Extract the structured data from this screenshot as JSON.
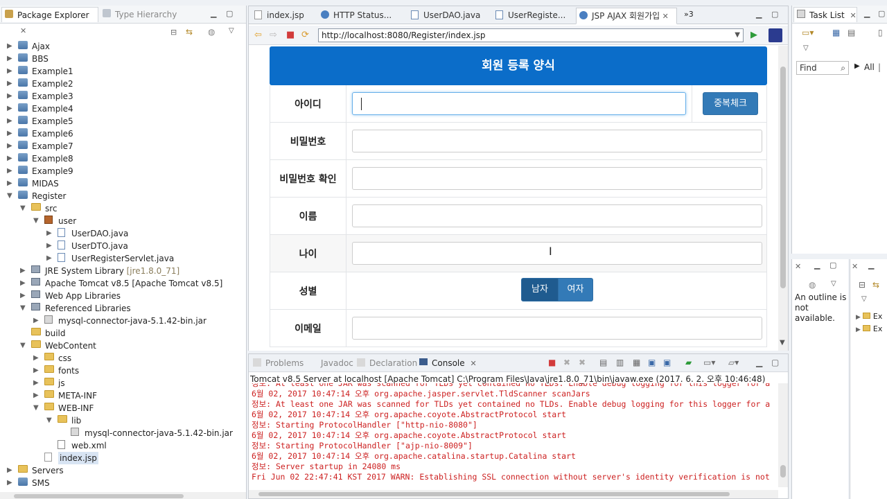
{
  "package_explorer": {
    "tab_label": "Package Explorer",
    "tab2_label": "Type Hierarchy",
    "tree": [
      {
        "label": "Ajax",
        "depth": 0,
        "icon": "project-icon",
        "expanded": false
      },
      {
        "label": "BBS",
        "depth": 0,
        "icon": "project-icon",
        "expanded": false
      },
      {
        "label": "Example1",
        "depth": 0,
        "icon": "project-icon",
        "expanded": false
      },
      {
        "label": "Example2",
        "depth": 0,
        "icon": "project-icon",
        "expanded": false
      },
      {
        "label": "Example3",
        "depth": 0,
        "icon": "project-icon",
        "expanded": false
      },
      {
        "label": "Example4",
        "depth": 0,
        "icon": "project-icon",
        "expanded": false
      },
      {
        "label": "Example5",
        "depth": 0,
        "icon": "project-icon",
        "expanded": false
      },
      {
        "label": "Example6",
        "depth": 0,
        "icon": "project-icon",
        "expanded": false
      },
      {
        "label": "Example7",
        "depth": 0,
        "icon": "project-icon",
        "expanded": false
      },
      {
        "label": "Example8",
        "depth": 0,
        "icon": "project-icon",
        "expanded": false
      },
      {
        "label": "Example9",
        "depth": 0,
        "icon": "project-icon",
        "expanded": false
      },
      {
        "label": "MIDAS",
        "depth": 0,
        "icon": "project-icon",
        "expanded": false
      },
      {
        "label": "Register",
        "depth": 0,
        "icon": "project-icon",
        "expanded": true
      },
      {
        "label": "src",
        "depth": 1,
        "icon": "source-folder-icon",
        "expanded": true
      },
      {
        "label": "user",
        "depth": 2,
        "icon": "package-icon",
        "expanded": true
      },
      {
        "label": "UserDAO.java",
        "depth": 3,
        "icon": "java-file-icon",
        "expanded": false
      },
      {
        "label": "UserDTO.java",
        "depth": 3,
        "icon": "java-file-icon",
        "expanded": false
      },
      {
        "label": "UserRegisterServlet.java",
        "depth": 3,
        "icon": "java-file-icon",
        "expanded": false
      },
      {
        "label": "JRE System Library",
        "deco": "[jre1.8.0_71]",
        "depth": 1,
        "icon": "library-icon",
        "expanded": false
      },
      {
        "label": "Apache Tomcat v8.5 [Apache Tomcat v8.5]",
        "depth": 1,
        "icon": "library-icon",
        "expanded": false
      },
      {
        "label": "Web App Libraries",
        "depth": 1,
        "icon": "library-icon",
        "expanded": false
      },
      {
        "label": "Referenced Libraries",
        "depth": 1,
        "icon": "library-icon",
        "expanded": true
      },
      {
        "label": "mysql-connector-java-5.1.42-bin.jar",
        "depth": 2,
        "icon": "jar-icon",
        "expanded": false
      },
      {
        "label": "build",
        "depth": 1,
        "icon": "folder-icon",
        "expanded": null
      },
      {
        "label": "WebContent",
        "depth": 1,
        "icon": "folder-icon",
        "expanded": true
      },
      {
        "label": "css",
        "depth": 2,
        "icon": "folder-icon",
        "expanded": false
      },
      {
        "label": "fonts",
        "depth": 2,
        "icon": "folder-icon",
        "expanded": false
      },
      {
        "label": "js",
        "depth": 2,
        "icon": "folder-icon",
        "expanded": false
      },
      {
        "label": "META-INF",
        "depth": 2,
        "icon": "folder-icon",
        "expanded": false
      },
      {
        "label": "WEB-INF",
        "depth": 2,
        "icon": "folder-icon",
        "expanded": true
      },
      {
        "label": "lib",
        "depth": 3,
        "icon": "folder-icon",
        "expanded": true
      },
      {
        "label": "mysql-connector-java-5.1.42-bin.jar",
        "depth": 4,
        "icon": "jar-icon",
        "expanded": null
      },
      {
        "label": "web.xml",
        "depth": 3,
        "icon": "xml-file-icon",
        "expanded": null
      },
      {
        "label": "index.jsp",
        "depth": 2,
        "icon": "jsp-file-icon",
        "expanded": null,
        "selected": true
      },
      {
        "label": "Servers",
        "depth": 0,
        "icon": "folder-icon",
        "expanded": false
      },
      {
        "label": "SMS",
        "depth": 0,
        "icon": "project-icon",
        "expanded": false
      }
    ]
  },
  "editor": {
    "tabs": [
      {
        "label": "index.jsp",
        "icon": "jsp-file-icon"
      },
      {
        "label": "HTTP Status...",
        "icon": "globe-icon"
      },
      {
        "label": "UserDAO.java",
        "icon": "java-file-icon"
      },
      {
        "label": "UserRegiste...",
        "icon": "java-file-icon"
      },
      {
        "label": "JSP AJAX 회원가입",
        "icon": "globe-icon",
        "active": true
      }
    ],
    "overflow_label": "»3",
    "url": "http://localhost:8080/Register/index.jsp",
    "form": {
      "title": "회원 등록 양식",
      "fields": [
        {
          "label": "아이디",
          "value": ""
        },
        {
          "label": "비밀번호",
          "value": ""
        },
        {
          "label": "비밀번호 확인",
          "value": ""
        },
        {
          "label": "이름",
          "value": ""
        },
        {
          "label": "나이",
          "value": ""
        },
        {
          "label": "성별"
        },
        {
          "label": "이메일",
          "value": ""
        }
      ],
      "dup_check_label": "중복체크",
      "gender_options": [
        "남자",
        "여자"
      ],
      "gender_selected": "남자"
    }
  },
  "console": {
    "tabs": [
      "Problems",
      "Javadoc",
      "Declaration",
      "Console"
    ],
    "active_tab": "Console",
    "header": "Tomcat v8.5 Server at localhost [Apache Tomcat] C:\\Program Files\\Java\\jre1.8.0_71\\bin\\javaw.exe (2017. 6. 2. 오후 10:46:48)",
    "lines": [
      "정보: At least one JAR was scanned for TLDs yet contained no TLDs. Enable debug logging for this logger for a",
      "6월 02, 2017 10:47:14 오후 org.apache.jasper.servlet.TldScanner scanJars",
      "정보: At least one JAR was scanned for TLDs yet contained no TLDs. Enable debug logging for this logger for a",
      "6월 02, 2017 10:47:14 오후 org.apache.coyote.AbstractProtocol start",
      "정보: Starting ProtocolHandler [\"http-nio-8080\"]",
      "6월 02, 2017 10:47:14 오후 org.apache.coyote.AbstractProtocol start",
      "정보: Starting ProtocolHandler [\"ajp-nio-8009\"]",
      "6월 02, 2017 10:47:14 오후 org.apache.catalina.startup.Catalina start",
      "정보: Server startup in 24080 ms",
      "Fri Jun 02 22:47:41 KST 2017 WARN: Establishing SSL connection without server's identity verification is not"
    ]
  },
  "task_list": {
    "tab_label": "Task List",
    "find_placeholder": "Find",
    "all_label": "All"
  },
  "outline": {
    "message": "An outline is not available.",
    "items": [
      "Ex",
      "Ex"
    ]
  },
  "colors": {
    "form_header": "#0b6dc9",
    "button_primary": "#337ab7",
    "console_text": "#cc1f1f"
  }
}
